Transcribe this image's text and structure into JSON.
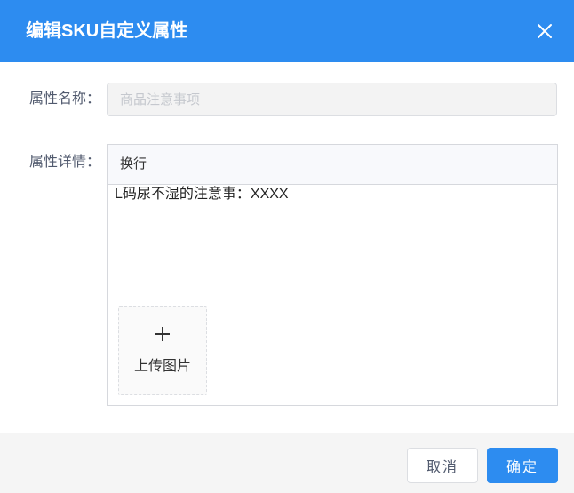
{
  "dialog": {
    "title": "编辑SKU自定义属性",
    "close_icon": "close-icon"
  },
  "form": {
    "name_label": "属性名称：",
    "name_placeholder": "商品注意事项",
    "detail_label": "属性详情："
  },
  "editor": {
    "toolbar_wrap_label": "换行",
    "content": "L码尿不湿的注意事：XXXX",
    "upload_icon": "plus-icon",
    "upload_label": "上传图片"
  },
  "footer": {
    "cancel_label": "取消",
    "ok_label": "确定"
  },
  "colors": {
    "header": "#2d8cf0",
    "primary_button": "#2d8cf0",
    "footer": "#f5f5f5"
  }
}
